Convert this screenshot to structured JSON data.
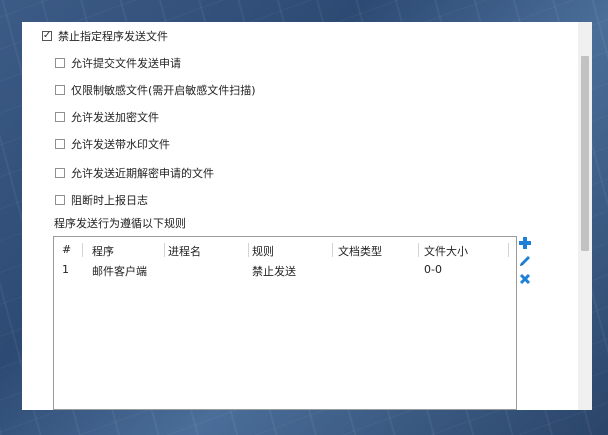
{
  "options": {
    "main": {
      "label": "禁止指定程序发送文件",
      "checked": true
    },
    "items": [
      {
        "label": "允许提交文件发送申请",
        "checked": false
      },
      {
        "label": "仅限制敏感文件(需开启敏感文件扫描)",
        "checked": false
      },
      {
        "label": "允许发送加密文件",
        "checked": false
      },
      {
        "label": "允许发送带水印文件",
        "checked": false
      },
      {
        "label": "允许发送近期解密申请的文件",
        "checked": false
      },
      {
        "label": "阻断时上报日志",
        "checked": false
      }
    ]
  },
  "rules_section": {
    "title": "程序发送行为遵循以下规则"
  },
  "table": {
    "columns": [
      "#",
      "程序",
      "进程名",
      "规则",
      "文档类型",
      "文件大小"
    ],
    "rows": [
      {
        "index": "1",
        "program": "邮件客户端",
        "process": "",
        "rule": "禁止发送",
        "doctype": "",
        "size": "0-0"
      }
    ]
  },
  "actions": {
    "add": "plus-icon",
    "edit": "pencil-icon",
    "delete": "x-icon"
  },
  "colors": {
    "accent": "#1e7fd6"
  }
}
